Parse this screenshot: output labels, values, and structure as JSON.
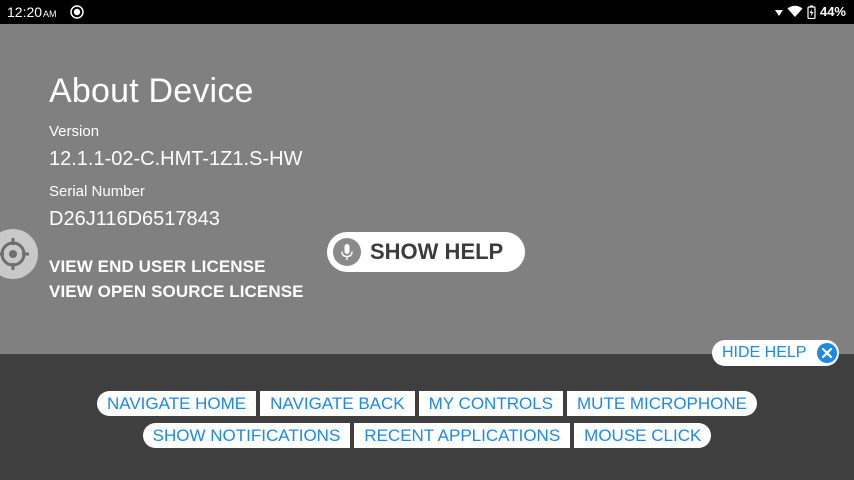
{
  "status_bar": {
    "time": "12:20",
    "ampm": "AM",
    "battery": "44%"
  },
  "about": {
    "title": "About Device",
    "version_label": "Version",
    "version_value": "12.1.1-02-C.HMT-1Z1.S-HW",
    "serial_label": "Serial Number",
    "serial_value": "D26J116D6517843",
    "link_eula": "VIEW END USER LICENSE",
    "link_oss": "VIEW OPEN SOURCE LICENSE"
  },
  "help": {
    "show_help": "SHOW HELP",
    "hide_help": "HIDE HELP",
    "row1": [
      "NAVIGATE HOME",
      "NAVIGATE BACK",
      "MY CONTROLS",
      "MUTE MICROPHONE"
    ],
    "row2": [
      "SHOW NOTIFICATIONS",
      "RECENT APPLICATIONS",
      "MOUSE CLICK"
    ]
  },
  "colors": {
    "accent": "#1e88e5",
    "panel": "#808080",
    "help_bg": "#3f3f3f"
  }
}
